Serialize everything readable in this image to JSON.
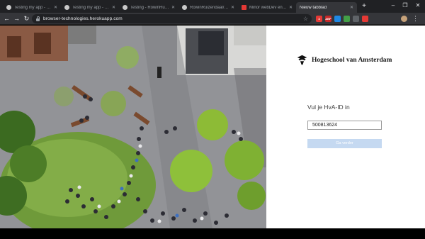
{
  "browser": {
    "tabs": [
      {
        "title": "Testing my app - Stanli...",
        "icon": "github-icon",
        "active": false
      },
      {
        "title": "Testing my app - Stanli...",
        "icon": "github-icon",
        "active": false
      },
      {
        "title": "Testing - RowinRuizendaa...",
        "icon": "github-icon",
        "active": false
      },
      {
        "title": "RowinRuizendaal/brow...",
        "icon": "github-icon",
        "active": false
      },
      {
        "title": "Minor webDev enquête",
        "icon": "minor-icon",
        "active": false
      },
      {
        "title": "Nieuw tabblad",
        "icon": "",
        "active": true
      }
    ],
    "new_tab_label": "+",
    "window_controls": {
      "minimize": "–",
      "maximize": "❐",
      "close": "✕"
    },
    "nav": {
      "back": "←",
      "forward": "→",
      "reload": "↻"
    },
    "address": {
      "url": "browser-technologies.herokuapp.com"
    },
    "extensions": [
      {
        "label": "4",
        "color": "#e53935"
      },
      {
        "label": "ABP",
        "color": "#c62828"
      },
      {
        "label": "",
        "color": "#1e88e5"
      },
      {
        "label": "",
        "color": "#43a047"
      },
      {
        "label": "",
        "color": "#5f6368"
      },
      {
        "label": "",
        "color": "#e53935"
      }
    ],
    "menu": "⋮"
  },
  "page": {
    "brand": {
      "name": "Hogeschool van Amsterdam"
    },
    "login": {
      "prompt": "Vul je HvA-ID in",
      "input_value": "500813624",
      "button_label": "Ga verder"
    }
  },
  "colors": {
    "chrome_dark": "#202124",
    "toolbar": "#35363a",
    "button": "#c5d9f1"
  }
}
